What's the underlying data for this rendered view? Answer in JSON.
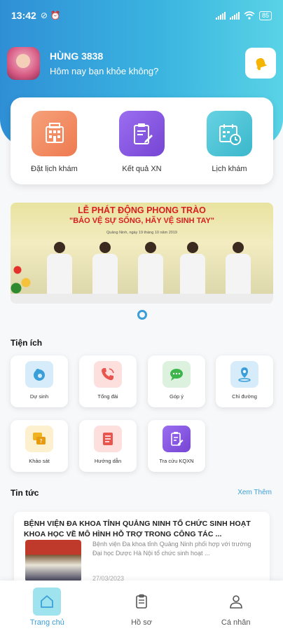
{
  "status_bar": {
    "time": "13:42",
    "battery": "85"
  },
  "user": {
    "name": "HÙNG 3838",
    "greeting": "Hôm nay bạn khỏe không?"
  },
  "quick_actions": [
    {
      "label": "Đặt lịch khám",
      "icon": "hospital-building-icon",
      "color": "#f08a5d"
    },
    {
      "label": "Kết quả XN",
      "icon": "clipboard-edit-icon",
      "color": "#8a58e0"
    },
    {
      "label": "Lịch khám",
      "icon": "calendar-clock-icon",
      "color": "#4fc3d6"
    }
  ],
  "banner": {
    "title": "LỄ PHÁT ĐỘNG PHONG TRÀO",
    "subtitle": "\"BẢO VỆ SỰ SỐNG, HÃY VỆ SINH TAY\"",
    "date_line": "Quảng Ninh, ngày 19 tháng 10 năm 2019"
  },
  "utilities": {
    "title": "Tiện ích",
    "items": [
      {
        "label": "Dự sinh",
        "icon": "pregnancy-icon",
        "color": "#3a9fd8"
      },
      {
        "label": "Tổng đài",
        "icon": "phone-icon",
        "color": "#e8554e"
      },
      {
        "label": "Góp ý",
        "icon": "chat-feedback-icon",
        "color": "#3cb54a"
      },
      {
        "label": "Chỉ đường",
        "icon": "map-pin-icon",
        "color": "#3a9fd8"
      },
      {
        "label": "Khảo sát",
        "icon": "survey-icon",
        "color": "#f0b21e"
      },
      {
        "label": "Hướng dẫn",
        "icon": "guide-book-icon",
        "color": "#e8554e"
      },
      {
        "label": "Tra cứu KQXN",
        "icon": "lookup-clipboard-icon",
        "color": "#8a58e0"
      }
    ]
  },
  "news": {
    "title": "Tin tức",
    "see_more": "Xem Thêm",
    "items": [
      {
        "title": "BỆNH VIỆN ĐA KHOA TỈNH QUẢNG NINH TỔ CHỨC SINH HOẠT KHOA HỌC VỀ MÔ HÌNH HỖ TRỢ TRONG CÔNG TÁC ...",
        "excerpt": "Bệnh viện Đa khoa tỉnh Quảng Ninh phối hợp với trường Đại học Dược Hà Nội tổ chức sinh hoạt ...",
        "date": "27/03/2023"
      }
    ]
  },
  "bottom_nav": [
    {
      "label": "Trang chủ",
      "icon": "home-icon",
      "active": true
    },
    {
      "label": "Hồ sơ",
      "icon": "document-icon",
      "active": false
    },
    {
      "label": "Cá nhân",
      "icon": "person-icon",
      "active": false
    }
  ]
}
